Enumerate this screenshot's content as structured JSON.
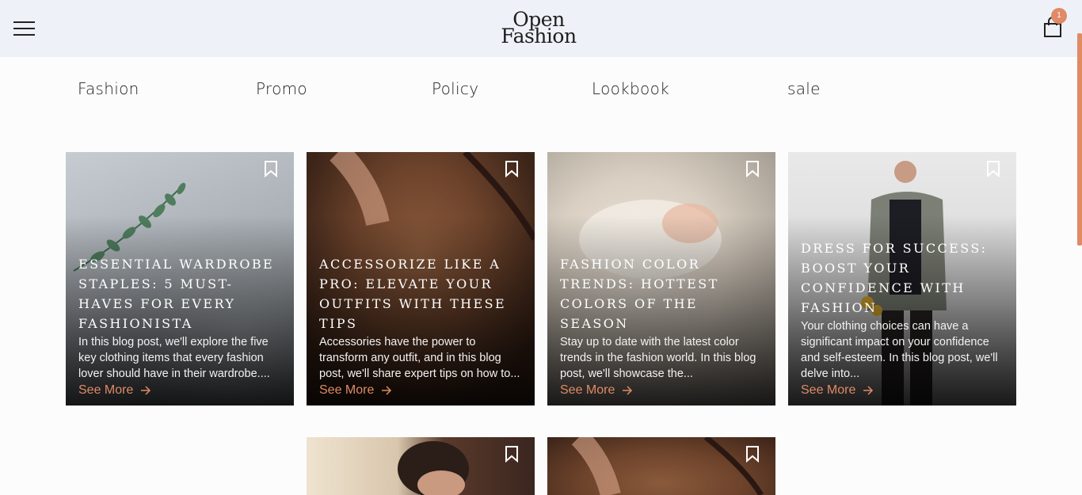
{
  "header": {
    "logo_line1": "Open",
    "logo_line2": "Fashion",
    "cart_count": "1",
    "icons": [
      "menu-icon",
      "shopping-bag-icon"
    ]
  },
  "nav": [
    {
      "label": "Fashion"
    },
    {
      "label": "Promo"
    },
    {
      "label": "Policy"
    },
    {
      "label": "Lookbook"
    },
    {
      "label": "sale"
    }
  ],
  "cards": [
    {
      "title": "Essential Wardrobe Staples: 5 Must-Haves for Every Fashionista",
      "desc": "In this blog post, we'll explore the five key clothing items that every fashion lover should have in their wardrobe....",
      "cta": "See More"
    },
    {
      "title": "Accessorize Like a Pro: Elevate Your Outfits with These Tips",
      "desc": "Accessories have the power to transform any outfit, and in this blog post, we'll share expert tips on how to...",
      "cta": "See More"
    },
    {
      "title": "Fashion Color Trends: Hottest Colors of the Season",
      "desc": "Stay up to date with the latest color trends in the fashion world. In this blog post, we'll showcase the...",
      "cta": "See More"
    },
    {
      "title": "Dress for Success: Boost Your Confidence with Fashion",
      "desc": "Your clothing choices can have a significant impact on your confidence and self-esteem. In this blog post, we'll delve into...",
      "cta": "See More"
    }
  ],
  "colors": {
    "accent": "#e08a66",
    "header_bg": "#eef1f8",
    "page_bg": "#fcfcfc"
  }
}
